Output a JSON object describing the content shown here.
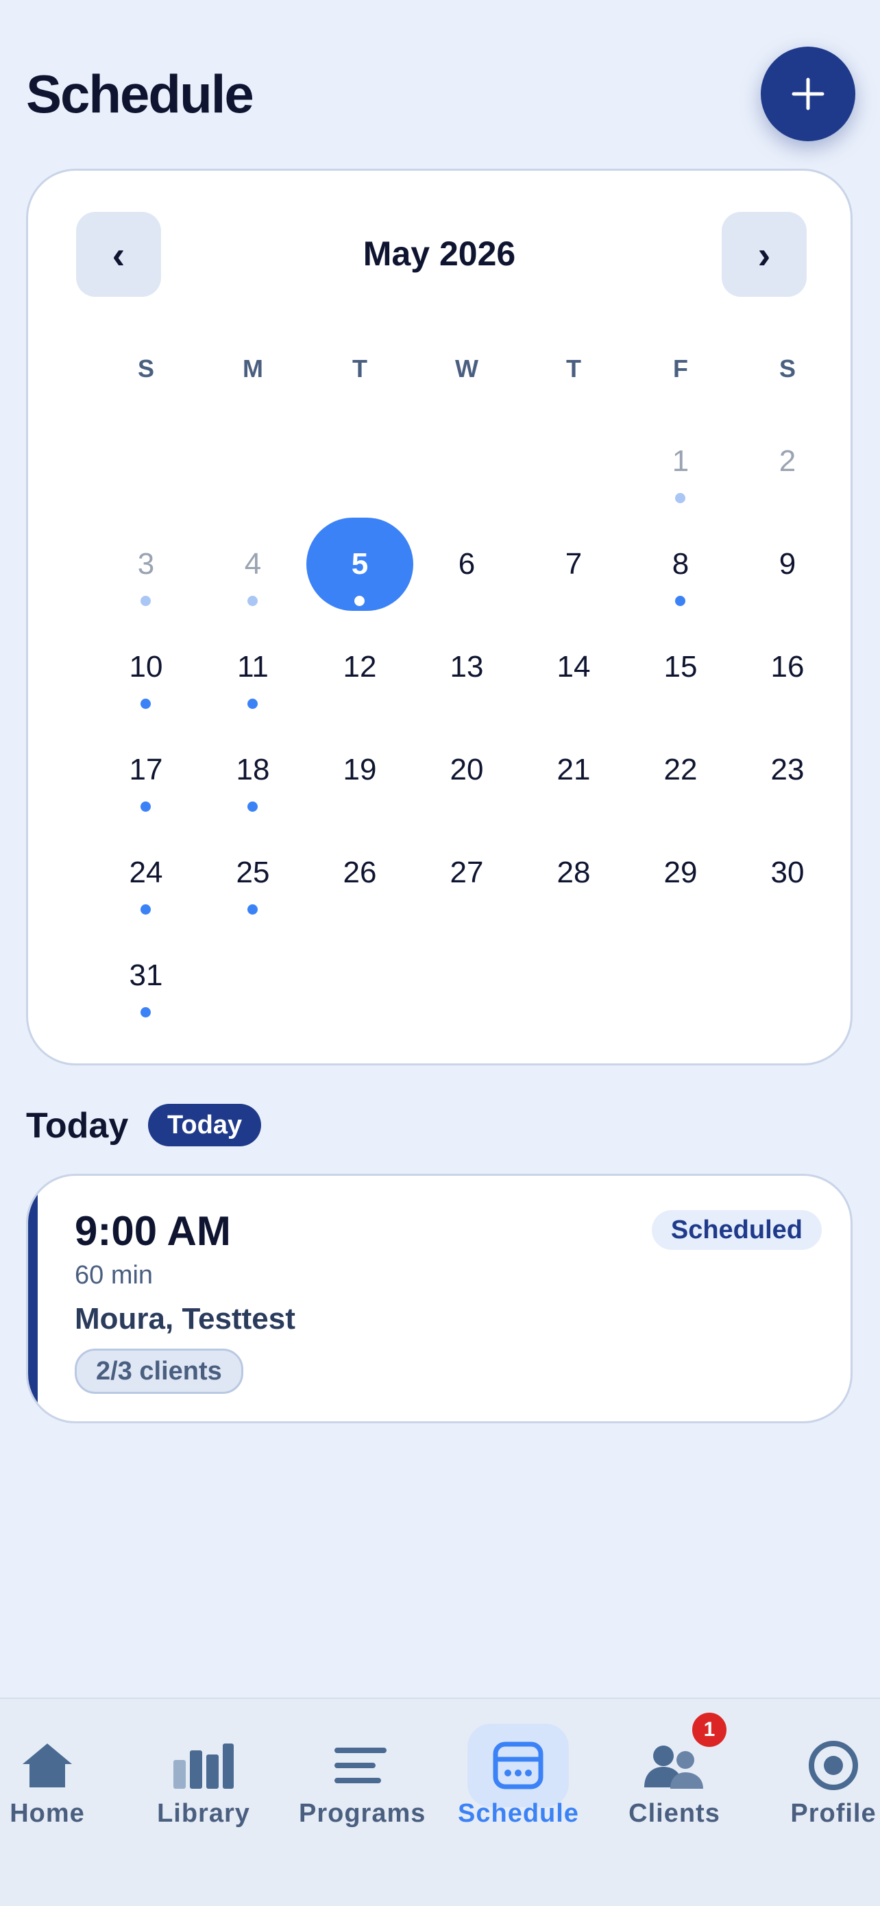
{
  "header": {
    "title": "Schedule",
    "add_icon": "plus-icon"
  },
  "calendar": {
    "month_label": "May 2026",
    "prev_label": "‹",
    "next_label": "›",
    "weekdays": [
      "S",
      "M",
      "T",
      "W",
      "T",
      "F",
      "S"
    ],
    "selected_day": "5",
    "weeks": [
      [
        null,
        null,
        null,
        null,
        null,
        {
          "d": "1",
          "muted": true,
          "dot": true
        },
        {
          "d": "2",
          "muted": true,
          "dot": false
        }
      ],
      [
        {
          "d": "3",
          "muted": true,
          "dot": true
        },
        {
          "d": "4",
          "muted": true,
          "dot": true
        },
        {
          "d": "5",
          "selected": true,
          "dot": true
        },
        {
          "d": "6"
        },
        {
          "d": "7"
        },
        {
          "d": "8",
          "dot": true
        },
        {
          "d": "9"
        }
      ],
      [
        {
          "d": "10",
          "dot": true
        },
        {
          "d": "11",
          "dot": true
        },
        {
          "d": "12"
        },
        {
          "d": "13"
        },
        {
          "d": "14"
        },
        {
          "d": "15"
        },
        {
          "d": "16"
        }
      ],
      [
        {
          "d": "17",
          "dot": true
        },
        {
          "d": "18",
          "dot": true
        },
        {
          "d": "19"
        },
        {
          "d": "20"
        },
        {
          "d": "21"
        },
        {
          "d": "22"
        },
        {
          "d": "23"
        }
      ],
      [
        {
          "d": "24",
          "dot": true
        },
        {
          "d": "25",
          "dot": true
        },
        {
          "d": "26"
        },
        {
          "d": "27"
        },
        {
          "d": "28"
        },
        {
          "d": "29"
        },
        {
          "d": "30"
        }
      ],
      [
        {
          "d": "31",
          "dot": true
        },
        null,
        null,
        null,
        null,
        null,
        null
      ]
    ]
  },
  "today_section": {
    "title": "Today",
    "badge": "Today"
  },
  "session": {
    "time": "9:00 AM",
    "duration": "60 min",
    "name": "Moura, Testtest",
    "clients": "2/3 clients",
    "status": "Scheduled"
  },
  "tabbar": {
    "tabs": [
      {
        "label": "Home",
        "icon": "home-icon"
      },
      {
        "label": "Library",
        "icon": "library-icon"
      },
      {
        "label": "Programs",
        "icon": "programs-icon"
      },
      {
        "label": "Schedule",
        "icon": "schedule-icon",
        "active": true
      },
      {
        "label": "Clients",
        "icon": "clients-icon",
        "badge": "1"
      },
      {
        "label": "Profile",
        "icon": "profile-icon"
      }
    ]
  },
  "colors": {
    "accent": "#3b82f6",
    "navy": "#1f3a8a",
    "background": "#eaf0fb"
  }
}
